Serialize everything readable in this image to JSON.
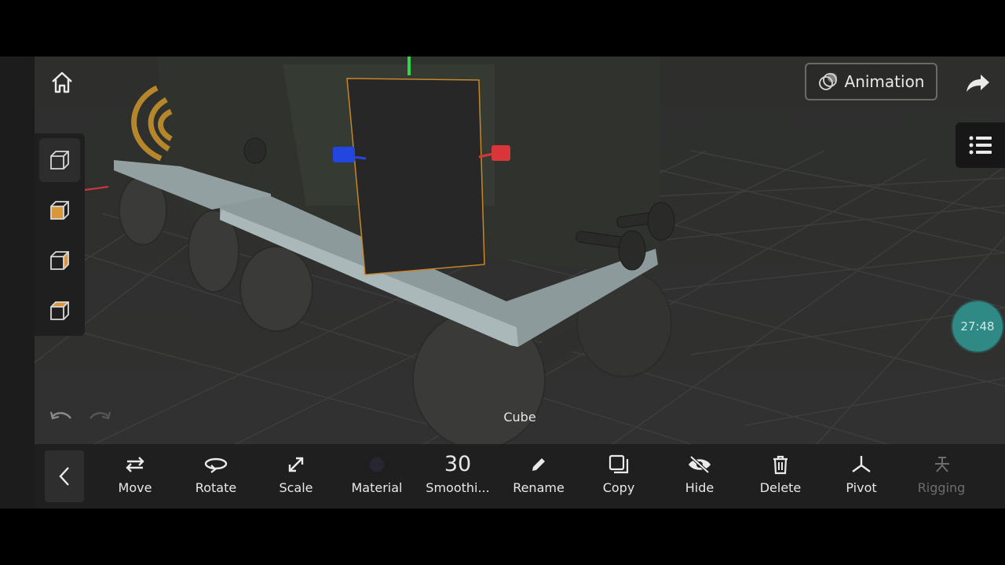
{
  "header": {
    "animation_label": "Animation"
  },
  "viewport": {
    "selected_object_label": "Cube",
    "timer": "27:48"
  },
  "icons": {
    "home": "home-icon",
    "views": [
      "cube-view-icon",
      "cube-front-icon",
      "cube-side-icon",
      "cube-top-icon"
    ],
    "undo": "undo-icon",
    "redo": "redo-icon",
    "share": "share-arrow-icon",
    "list": "list-icon",
    "collapse": "chevron-left-icon"
  },
  "toolbar": {
    "items": [
      {
        "label": "Move",
        "icon": "move-arrows-icon"
      },
      {
        "label": "Rotate",
        "icon": "rotate-icon"
      },
      {
        "label": "Scale",
        "icon": "scale-icon"
      },
      {
        "label": "Material",
        "icon": "material-swatch-icon"
      },
      {
        "label": "Smoothi...",
        "value": "30"
      },
      {
        "label": "Rename",
        "icon": "pencil-icon"
      },
      {
        "label": "Copy",
        "icon": "copy-icon"
      },
      {
        "label": "Hide",
        "icon": "eye-off-icon"
      },
      {
        "label": "Delete",
        "icon": "trash-icon"
      },
      {
        "label": "Pivot",
        "icon": "pivot-icon"
      },
      {
        "label": "Rigging",
        "icon": "rigging-icon",
        "disabled": true
      }
    ]
  },
  "colors": {
    "background": "#2a2b29",
    "toolbar": "#1e1f1e",
    "accent_teal": "#2f8a86",
    "selection_outline": "#c8862a",
    "axis_x": "#d9363a",
    "axis_y": "#2bd94b",
    "axis_z": "#2446e0"
  }
}
